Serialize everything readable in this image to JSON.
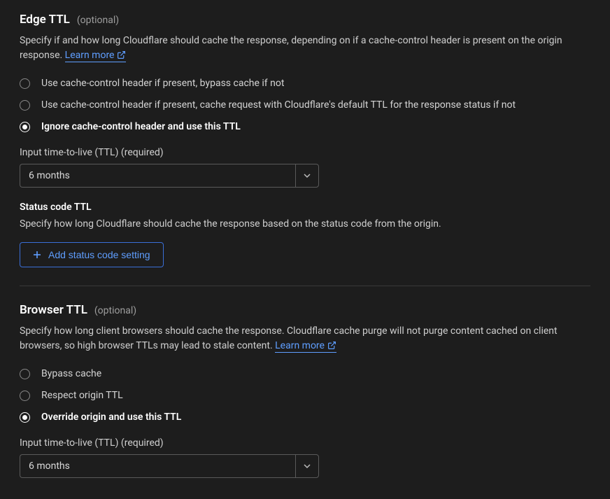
{
  "edge": {
    "title": "Edge TTL",
    "optional": "(optional)",
    "description": "Specify if and how long Cloudflare should cache the response, depending on if a cache-control header is present on the origin response. ",
    "learn_more": "Learn more",
    "options": [
      "Use cache-control header if present, bypass cache if not",
      "Use cache-control header if present, cache request with Cloudflare's default TTL for the response status if not",
      "Ignore cache-control header and use this TTL"
    ],
    "ttl_label": "Input time-to-live (TTL) (required)",
    "ttl_value": "6 months",
    "status_title": "Status code TTL",
    "status_desc": "Specify how long Cloudflare should cache the response based on the status code from the origin.",
    "add_button": "Add status code setting"
  },
  "browser": {
    "title": "Browser TTL",
    "optional": "(optional)",
    "description": "Specify how long client browsers should cache the response. Cloudflare cache purge will not purge content cached on client browsers, so high browser TTLs may lead to stale content. ",
    "learn_more": "Learn more",
    "options": [
      "Bypass cache",
      "Respect origin TTL",
      "Override origin and use this TTL"
    ],
    "ttl_label": "Input time-to-live (TTL) (required)",
    "ttl_value": "6 months"
  }
}
